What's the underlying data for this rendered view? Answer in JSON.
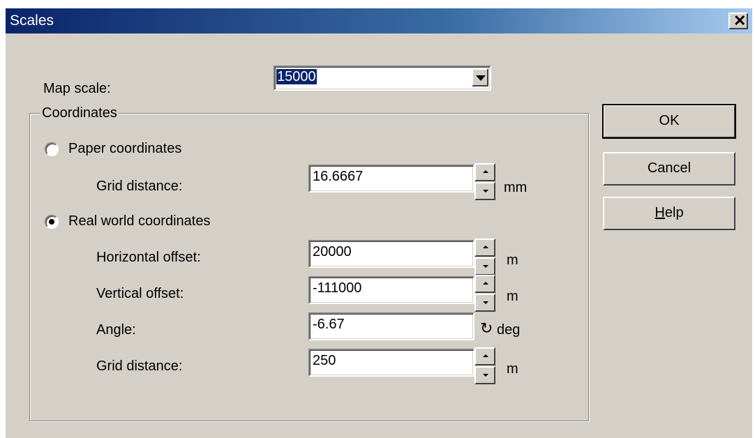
{
  "window": {
    "title": "Scales"
  },
  "map_scale": {
    "label": "Map scale:",
    "value": "15000"
  },
  "coordinates": {
    "group_title": "Coordinates",
    "paper": {
      "label": "Paper coordinates",
      "selected": false,
      "grid_distance": {
        "label": "Grid distance:",
        "value": "16.6667",
        "unit": "mm"
      }
    },
    "real_world": {
      "label": "Real world coordinates",
      "selected": true,
      "horizontal_offset": {
        "label": "Horizontal offset:",
        "value": "20000",
        "unit": "m"
      },
      "vertical_offset": {
        "label": "Vertical offset:",
        "value": "-111000",
        "unit": "m"
      },
      "angle": {
        "label": "Angle:",
        "value": "-6.67",
        "icon": "rotate-icon",
        "unit": "deg"
      },
      "grid_distance": {
        "label": "Grid distance:",
        "value": "250",
        "unit": "m"
      }
    }
  },
  "buttons": {
    "ok": "OK",
    "cancel": "Cancel",
    "help_first": "H",
    "help_rest": "elp"
  },
  "colors": {
    "title_start": "#0a246a",
    "title_end": "#a6caf0",
    "face": "#d4d0c8",
    "selection": "#0a246a"
  }
}
